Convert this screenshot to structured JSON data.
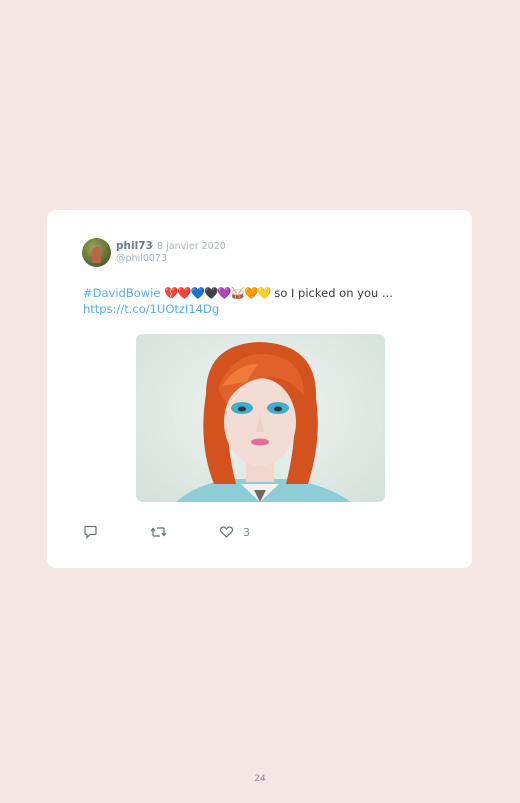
{
  "tweet": {
    "author_name": "phil73",
    "date": "· 8 janvier 2020",
    "handle": "@phil0073",
    "hashtag": "#DavidBowie",
    "emojis": "💔❤️💙🖤💜🥁🧡💛",
    "text_after": " so I picked on you ...",
    "link": "https://t.co/1UOtzI14Dg",
    "like_count": "3"
  },
  "icons": {
    "reply": "reply-icon",
    "retweet": "retweet-icon",
    "like": "heart-icon"
  },
  "page": {
    "number": "24"
  }
}
